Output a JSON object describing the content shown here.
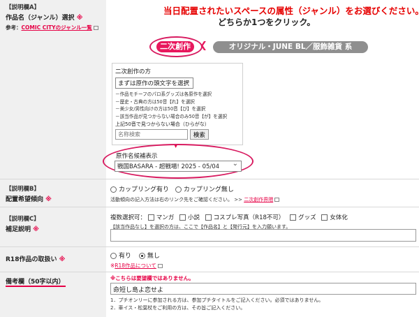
{
  "genre": {
    "section": "【説明欄A】",
    "label": "作品名（ジャンル）選択",
    "req": "※",
    "ref_prefix": "参考：",
    "ref_link": "COMIC CITYのジャンル一覧",
    "heading": "当日配置されたいスペースの属性（ジャンル）をお選びください。",
    "subheading": "どちらか1つをクリック。",
    "tab_derivative": "二次創作",
    "tab_original": "オリジナル・JUNE BL／服飾雑貨 系",
    "panel_title": "二次創作の方",
    "initial_select": "まずは原作の頭文字を選択",
    "notes": [
      "－作品モチーフのパロ系グッズは各原作を選択",
      "－歴史・古典の方は50音【れ】を選択",
      "－美少女/男性向けの方は50音【び】を選択",
      "－該当作品が見つからない場合のみ50音【が】を選択"
    ],
    "kana_note": "上記50音で見つからない場合（ひらがな）",
    "search_placeholder": "名称検索",
    "search_button": "検索",
    "candidate_label": "原作名候補表示",
    "candidate_value": "戦国BASARA - 超戦場! 2025 - 05/04"
  },
  "coupling": {
    "section": "【説明欄B】",
    "label": "配置希望傾向",
    "req": "※",
    "option1": "カップリング有り",
    "option2": "カップリング無し",
    "note": "活動傾向の記入方法は右のリンク先をご確認ください。 >>",
    "note_link": "二次創作界隈"
  },
  "supplement": {
    "section": "【説明欄C】",
    "label": "補足説明",
    "req": "※",
    "multi_label": "複数選択可：",
    "options": [
      "マンガ",
      "小説",
      "コスプレ写真（R18不可）",
      "グッズ",
      "女体化"
    ],
    "note": "【該当作品なし】を選択の方は、ここで【作品名】と【発行元】を入力願います。"
  },
  "r18": {
    "label": "R18作品の取扱い",
    "req": "※",
    "option_yes": "有り",
    "option_no": "無し",
    "link": "R18作品について"
  },
  "remarks": {
    "label": "備考欄（50字以内）",
    "warning": "※こちらは要望欄ではありません。",
    "value": "命短し島よ恋せよ",
    "notes": [
      "1．プチオンリーに参加される方は、参加プチタイトルをご記入ください。必須ではありません。",
      "2．車イス・松葉杖をご利用の方は、その旨ご記入ください。"
    ]
  }
}
